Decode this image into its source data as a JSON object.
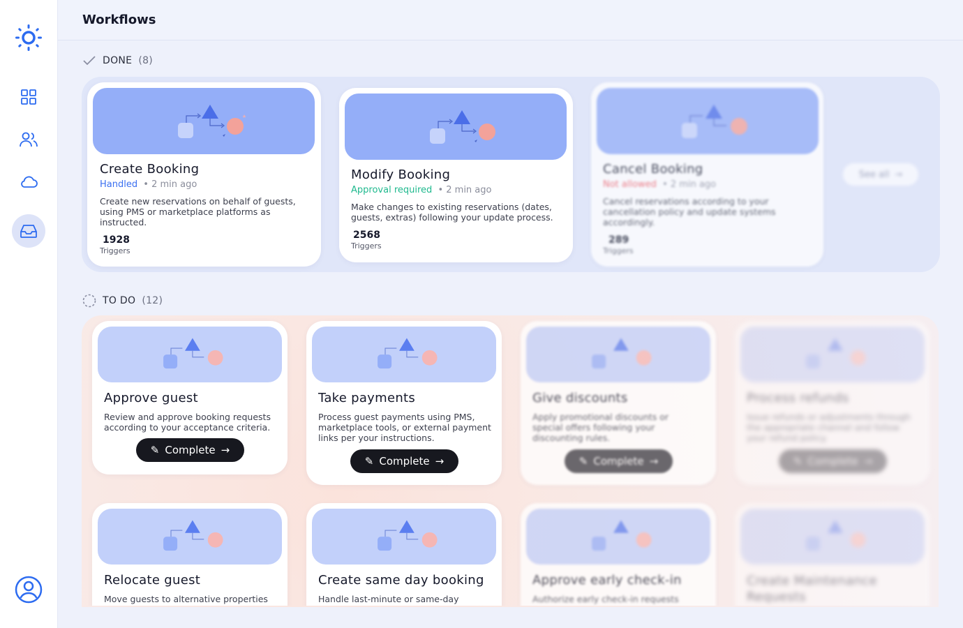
{
  "header": {
    "title": "Workflows"
  },
  "sections": {
    "done": {
      "label": "DONE",
      "count": "(8)"
    },
    "todo": {
      "label": "TO DO",
      "count": "(12)"
    }
  },
  "done_cards": [
    {
      "title": "Create Booking",
      "status": "Handled",
      "time": "2 min ago",
      "description": "Create new reservations on behalf of guests, using PMS or marketplace platforms as instructed.",
      "triggers": "1928",
      "triggers_label": "Triggers"
    },
    {
      "title": "Modify Booking",
      "status": "Approval required",
      "time": "2 min ago",
      "description": "Make changes to existing reservations (dates, guests, extras) following your update process.",
      "triggers": "2568",
      "triggers_label": "Triggers"
    },
    {
      "title": "Cancel Booking",
      "status": "Not allowed",
      "time": "2 min ago",
      "description": "Cancel reservations according to your cancellation policy and update systems accordingly.",
      "triggers": "289",
      "triggers_label": "Triggers"
    }
  ],
  "see_all": "See all",
  "todo_cards": [
    {
      "title": "Approve guest",
      "description": "Review and approve booking requests according to your acceptance criteria.",
      "button": "Complete"
    },
    {
      "title": "Take payments",
      "description": "Process guest payments using PMS, marketplace tools, or external payment links per your instructions.",
      "button": "Complete"
    },
    {
      "title": "Give discounts",
      "description": "Apply promotional discounts or special offers following your discounting rules.",
      "button": "Complete"
    },
    {
      "title": "Process refunds",
      "description": "Issue refunds or adjustments through the appropriate channel and follow your refund policy.",
      "button": "Complete"
    },
    {
      "title": "Relocate guest",
      "description": "Move guests to alternative properties"
    },
    {
      "title": "Create same day booking",
      "description": "Handle last-minute or same-day"
    },
    {
      "title": "Approve early check-in",
      "description": "Authorize early check-in requests"
    },
    {
      "title": "Create Maintenance Requests",
      "description": ""
    }
  ],
  "colors": {
    "handled": "#3a6ff0",
    "approval": "#1fb98e",
    "not_allowed": "#ef5b63",
    "accent": "#2c6bf0"
  },
  "icons": {
    "logo": "sun-gear-logo",
    "nav": [
      "grid-icon",
      "users-icon",
      "cloud-icon",
      "inbox-icon"
    ],
    "profile": "user-circle-icon"
  }
}
